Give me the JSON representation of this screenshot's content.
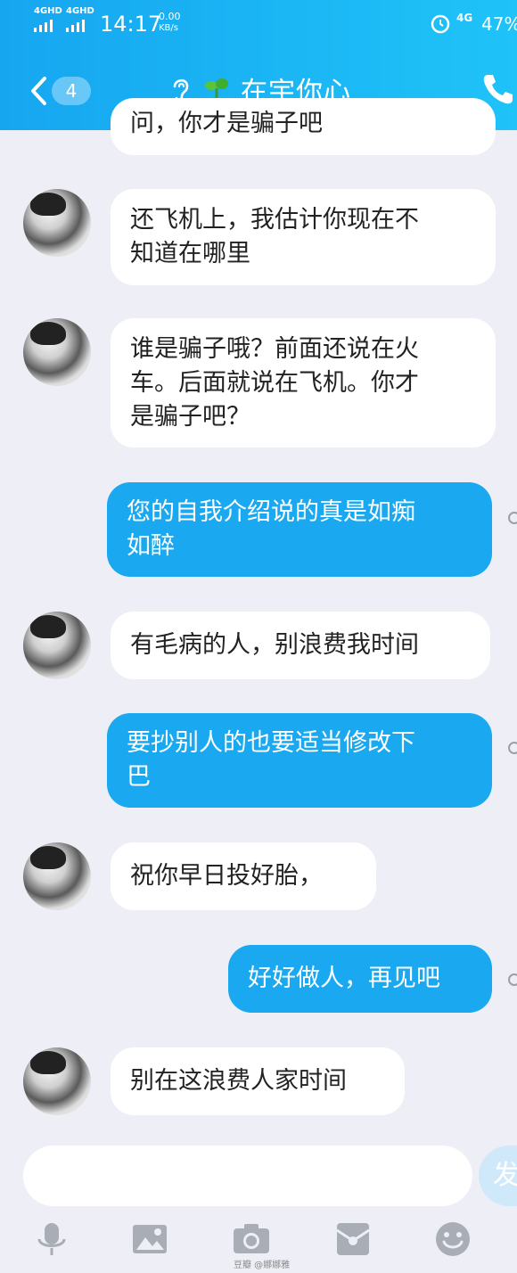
{
  "status_bar": {
    "signal1": "4GHD",
    "signal2": "4GHD",
    "time": "14:17",
    "speed_value": "0.00",
    "speed_unit": "KB/s",
    "net": "4G",
    "battery": "47%"
  },
  "header": {
    "unread_count": "4",
    "title": "在宇你心"
  },
  "messages": [
    {
      "side": "in",
      "text": "问，你才是骗子吧"
    },
    {
      "side": "in",
      "line1": "还飞机上，我估计你现在不",
      "line2": "知道在哪里"
    },
    {
      "side": "in",
      "line1": "谁是骗子哦？前面还说在火",
      "line2": "车。后面就说在飞机。你才",
      "line3": "是骗子吧？"
    },
    {
      "side": "out",
      "line1": "您的自我介绍说的真是如痴",
      "line2": "如醉"
    },
    {
      "side": "in",
      "text": "有毛病的人，别浪费我时间"
    },
    {
      "side": "out",
      "line1": "要抄别人的也要适当修改下",
      "line2": "巴"
    },
    {
      "side": "in",
      "text": "祝你早日投好胎，"
    },
    {
      "side": "out",
      "text": "好好做人，再见吧"
    },
    {
      "side": "in",
      "text": "别在这浪费人家时间"
    }
  ],
  "input": {
    "send_label": "发"
  },
  "toolbar": {
    "items": [
      "mic-icon",
      "image-icon",
      "camera-icon",
      "red-packet-icon",
      "emoji-icon"
    ]
  },
  "watermark": "豆瓣 @娜娜雅"
}
